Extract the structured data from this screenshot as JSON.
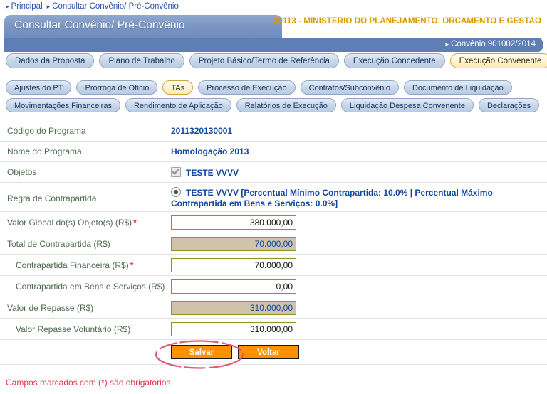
{
  "breadcrumb": {
    "items": [
      "Principal",
      "Consultar Convênio/ Pré-Convênio"
    ]
  },
  "header": {
    "title": "Consultar Convênio/ Pré-Convênio",
    "ministry": "20113 - MINISTERIO DO PLANEJAMENTO, ORCAMENTO E GESTAO",
    "convenio": "Convênio 901002/2014"
  },
  "tabs": {
    "row1": [
      {
        "label": "Dados da Proposta",
        "active": false
      },
      {
        "label": "Plano de Trabalho",
        "active": false
      },
      {
        "label": "Projeto Básico/Termo de Referência",
        "active": false
      },
      {
        "label": "Execução Concedente",
        "active": false
      },
      {
        "label": "Execução Convenente",
        "active": true
      }
    ],
    "row2": [
      {
        "label": "Ajustes do PT",
        "active": false
      },
      {
        "label": "Prorroga de Ofício",
        "active": false
      },
      {
        "label": "TAs",
        "active": true
      },
      {
        "label": "Processo de Execução",
        "active": false
      },
      {
        "label": "Contratos/Subconvênio",
        "active": false
      },
      {
        "label": "Documento de Liquidação",
        "active": false
      }
    ],
    "row3": [
      {
        "label": "Movimentações Financeiras",
        "active": false
      },
      {
        "label": "Rendimento de Aplicação",
        "active": false
      },
      {
        "label": "Relatórios de Execução",
        "active": false
      },
      {
        "label": "Liquidação Despesa Convenente",
        "active": false
      },
      {
        "label": "Declarações",
        "active": false
      }
    ]
  },
  "form": {
    "codigo_programa": {
      "label": "Código do Programa",
      "value": "2011320130001"
    },
    "nome_programa": {
      "label": "Nome do Programa",
      "value": "Homologação 2013"
    },
    "objetos": {
      "label": "Objetos",
      "value": "TESTE VVVV",
      "checked": true
    },
    "regra_contrapartida": {
      "label": "Regra de Contrapartida",
      "value": "TESTE VVVV [Percentual Mínimo Contrapartida: 10.0% | Percentual Máximo Contrapartida em Bens e Serviços: 0.0%]",
      "selected": true
    },
    "valor_global": {
      "label": "Valor Global do(s) Objeto(s) (R$)",
      "value": "380.000,00",
      "required": "*",
      "readonly": false
    },
    "total_contrapartida": {
      "label": "Total de Contrapartida (R$)",
      "value": "70.000,00",
      "required": "",
      "readonly": true
    },
    "contrapartida_financeira": {
      "label": "Contrapartida Financeira (R$)",
      "value": "70.000,00",
      "required": "*",
      "readonly": false
    },
    "contrapartida_bens": {
      "label": "Contrapartida em Bens e Serviços (R$)",
      "value": "0,00",
      "required": "",
      "readonly": false
    },
    "valor_repasse": {
      "label": "Valor de Repasse (R$)",
      "value": "310.000,00",
      "required": "",
      "readonly": true
    },
    "valor_repasse_voluntario": {
      "label": "Valor Repasse Voluntário (R$)",
      "value": "310.000,00",
      "required": "",
      "readonly": false
    }
  },
  "buttons": {
    "save": "Salvar",
    "back": "Voltar"
  },
  "footnote": "Campos marcados com (*) são obrigatórios",
  "colors": {
    "header_blue": "#6e8cbd",
    "bar_blue": "#5d7fb6",
    "ministry_gold": "#d99a00",
    "value_blue": "#12459e",
    "label_olive": "#4e6a4e",
    "input_border": "#9a8f1e",
    "readonly_bg": "#cfc3ab",
    "button_orange": "#ff9100",
    "annotation_red": "#e05a78",
    "footnote_red": "#e8344b",
    "tab_active_bg": "#fdf3cf"
  }
}
